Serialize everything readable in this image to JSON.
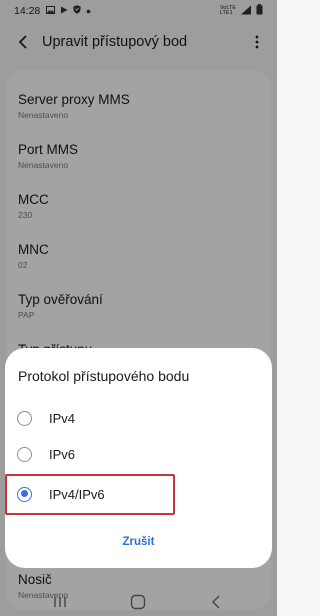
{
  "status_bar": {
    "time": "14:28",
    "network_tag_top": "VoLTE",
    "network_tag_bottom": "LTE1",
    "signal_gen": "4G",
    "left_icons": [
      "image-icon",
      "play-icon",
      "shield-icon",
      "dot-icon"
    ],
    "right_icons": [
      "signal-icon",
      "battery-icon"
    ]
  },
  "header": {
    "title": "Upravit přístupový bod"
  },
  "settings": [
    {
      "title": "Server proxy MMS",
      "value": "Nenastaveno"
    },
    {
      "title": "Port MMS",
      "value": "Nenastaveno"
    },
    {
      "title": "MCC",
      "value": "230"
    },
    {
      "title": "MNC",
      "value": "02"
    },
    {
      "title": "Typ ověřování",
      "value": "PAP"
    },
    {
      "title": "Typ přístupu",
      "value": ""
    },
    {
      "title": "Nosič",
      "value": "Nenastaveno"
    }
  ],
  "dialog": {
    "title": "Protokol přístupového bodu",
    "options": [
      {
        "label": "IPv4",
        "selected": false
      },
      {
        "label": "IPv6",
        "selected": false
      },
      {
        "label": "IPv4/IPv6",
        "selected": true
      }
    ],
    "cancel_label": "Zrušit"
  },
  "colors": {
    "accent": "#3d6ee0",
    "cancel_text": "#2f6fd6",
    "highlight": "#c8323a",
    "overlay": "#000000"
  },
  "nav_icons": [
    "recents-icon",
    "home-icon",
    "back-icon"
  ]
}
